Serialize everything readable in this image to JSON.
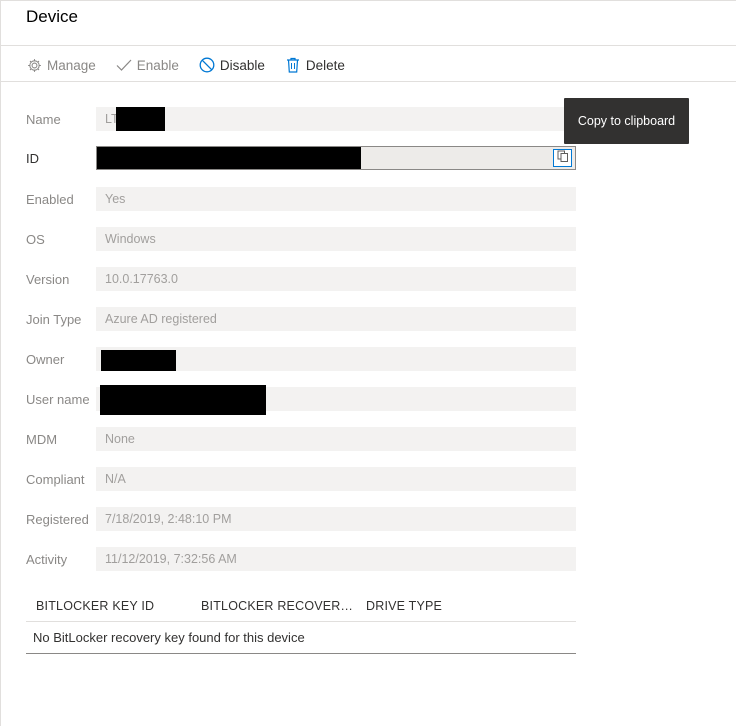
{
  "header": {
    "title": "Device"
  },
  "toolbar": {
    "manage_label": "Manage",
    "enable_label": "Enable",
    "disable_label": "Disable",
    "delete_label": "Delete",
    "icons": [
      "gear-icon",
      "checkmark-icon",
      "block-icon",
      "trash-icon"
    ]
  },
  "fields": {
    "name": {
      "label": "Name",
      "value": "LT"
    },
    "id": {
      "label": "ID",
      "value": ""
    },
    "enabled": {
      "label": "Enabled",
      "value": "Yes"
    },
    "os": {
      "label": "OS",
      "value": "Windows"
    },
    "version": {
      "label": "Version",
      "value": "10.0.17763.0"
    },
    "join_type": {
      "label": "Join Type",
      "value": "Azure AD registered"
    },
    "owner": {
      "label": "Owner",
      "value": ""
    },
    "user_name": {
      "label": "User name",
      "value": ""
    },
    "mdm": {
      "label": "MDM",
      "value": "None"
    },
    "compliant": {
      "label": "Compliant",
      "value": "N/A"
    },
    "registered": {
      "label": "Registered",
      "value": "7/18/2019, 2:48:10 PM"
    },
    "activity": {
      "label": "Activity",
      "value": "11/12/2019, 7:32:56 AM"
    }
  },
  "tooltip": {
    "text": "Copy to clipboard"
  },
  "bitlocker": {
    "columns": [
      "BITLOCKER KEY ID",
      "BITLOCKER RECOVERY K...",
      "DRIVE TYPE"
    ],
    "empty_message": "No BitLocker recovery key found for this device"
  },
  "colors": {
    "accent": "#0078d4",
    "field_bg": "#f3f2f1",
    "tooltip_bg": "#323130"
  }
}
